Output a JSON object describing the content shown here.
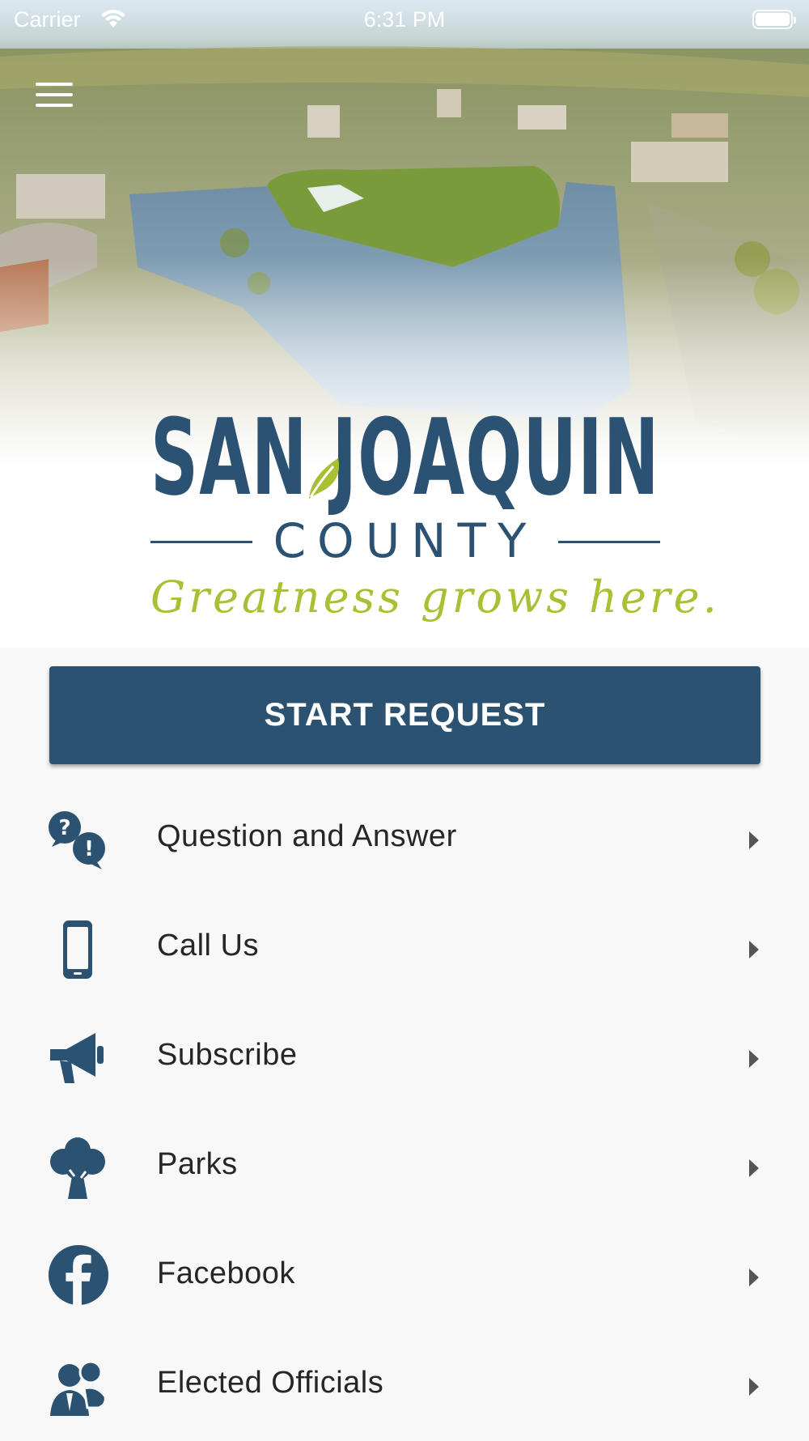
{
  "status_bar": {
    "carrier": "Carrier",
    "time": "6:31 PM"
  },
  "logo": {
    "name": "SAN JOAQUIN",
    "county": "COUNTY",
    "tagline": "Greatness grows here."
  },
  "cta": {
    "label": "START REQUEST"
  },
  "menu": [
    {
      "label": "Question and Answer",
      "icon": "question-answer-icon"
    },
    {
      "label": "Call Us",
      "icon": "phone-icon"
    },
    {
      "label": "Subscribe",
      "icon": "megaphone-icon"
    },
    {
      "label": "Parks",
      "icon": "tree-icon"
    },
    {
      "label": "Facebook",
      "icon": "facebook-icon"
    },
    {
      "label": "Elected Officials",
      "icon": "officials-icon"
    }
  ],
  "colors": {
    "brand_blue": "#2b5271",
    "brand_green": "#a7c133",
    "background": "#f8f8f8"
  }
}
